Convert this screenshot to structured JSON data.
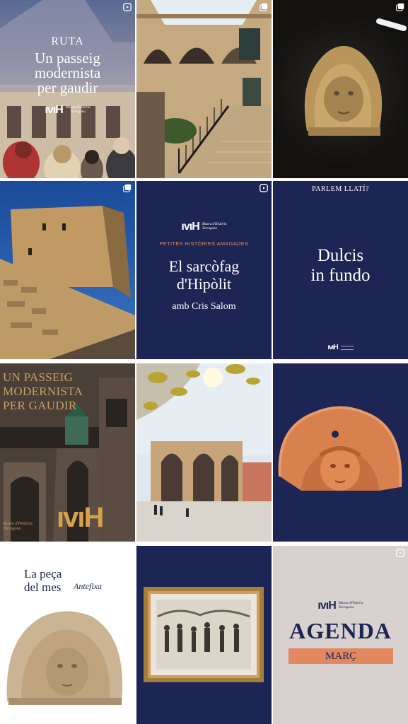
{
  "posts": [
    {
      "kicker": "RUTA",
      "title_l1": "Un passeig",
      "title_l2": "modernista",
      "title_l3": "per gaudir",
      "logo_mark": "ıvıH",
      "logo_l1": "Museu d'Història",
      "logo_l2": "Tarragona"
    },
    {},
    {},
    {},
    {
      "logo_mark": "ıvıH",
      "logo_l1": "Museu d'Història",
      "logo_l2": "Tarragona",
      "kicker": "PETITES HISTÒRIES AMAGADES",
      "title_l1": "El sarcòfag",
      "title_l2": "d'Hipòlit",
      "subtitle": "amb Cris Salom"
    },
    {
      "kicker": "PARLEM LLATÍ?",
      "title_l1": "Dulcis",
      "title_l2": "in fundo",
      "logo_mark": "ıvıH"
    },
    {
      "title_l1": "UN PASSEIG",
      "title_l2": "MODERNISTA",
      "title_l3": "PER GAUDIR",
      "logo_l1": "Museu d'Història",
      "logo_l2": "Tarragona",
      "logo_mark": "ıvıH"
    },
    {},
    {},
    {
      "title_l1": "La peça",
      "title_l2": "del mes",
      "subtitle": "Antefixa"
    },
    {},
    {
      "logo_mark": "ıvıH",
      "logo_l1": "Museu d'Història",
      "logo_l2": "Tarragona",
      "title": "AGENDA",
      "subtitle": "MARÇ"
    }
  ],
  "colors": {
    "navy": "#1c2553",
    "orange": "#e2875f",
    "gold": "#c9a060"
  }
}
